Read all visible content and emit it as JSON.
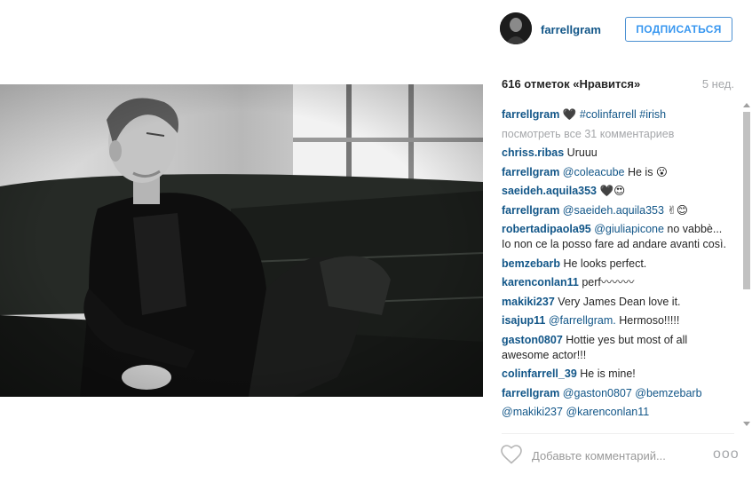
{
  "header": {
    "username": "farrellgram",
    "follow_label": "ПОДПИСАТЬСЯ"
  },
  "post": {
    "likes_text": "616 отметок «Нравится»",
    "age_text": "5 нед."
  },
  "caption": {
    "username": "farrellgram",
    "emoji": "🖤",
    "hashtags": "#colinfarrell #irish"
  },
  "view_all_comments": "посмотреть все 31 комментариев",
  "comments": [
    {
      "user": "chriss.ribas",
      "mention": "",
      "text": "Uruuu"
    },
    {
      "user": "farrellgram",
      "mention": "@coleacube",
      "text": "He is 😮"
    },
    {
      "user": "saeideh.aquila353",
      "mention": "",
      "text": "🖤😍"
    },
    {
      "user": "farrellgram",
      "mention": "@saeideh.aquila353",
      "text": "✌😊"
    },
    {
      "user": "robertadipaola95",
      "mention": "@giuliapicone",
      "text": "no vabbè... Io non ce la posso fare ad andare avanti così."
    },
    {
      "user": "bemzebarb",
      "mention": "",
      "text": "He looks perfect."
    },
    {
      "user": "karenconlan11",
      "mention": "",
      "text": "perf〰〰〰"
    },
    {
      "user": "makiki237",
      "mention": "",
      "text": "Very James Dean love it."
    },
    {
      "user": "isajup11",
      "mention": "@farrellgram.",
      "text": "Hermoso!!!!!"
    },
    {
      "user": "gaston0807",
      "mention": "",
      "text": "Hottie yes but most of all awesome actor!!!"
    },
    {
      "user": "colinfarrell_39",
      "mention": "",
      "text": "He is mine!"
    },
    {
      "user": "farrellgram",
      "mention": "@gaston0807 @bemzebarb",
      "text": ""
    },
    {
      "user": "@makiki237",
      "mention": "@karenconlan11",
      "text": ""
    }
  ],
  "footer": {
    "comment_placeholder": "Добавьте комментарий...",
    "more_options": "ooo"
  },
  "icons": {
    "like": "heart-outline-icon",
    "more": "more-dots-icon"
  },
  "colors": {
    "link": "#125688",
    "button_border": "#4b90d2",
    "button_text": "#3897f0",
    "muted": "#a5a7aa"
  }
}
